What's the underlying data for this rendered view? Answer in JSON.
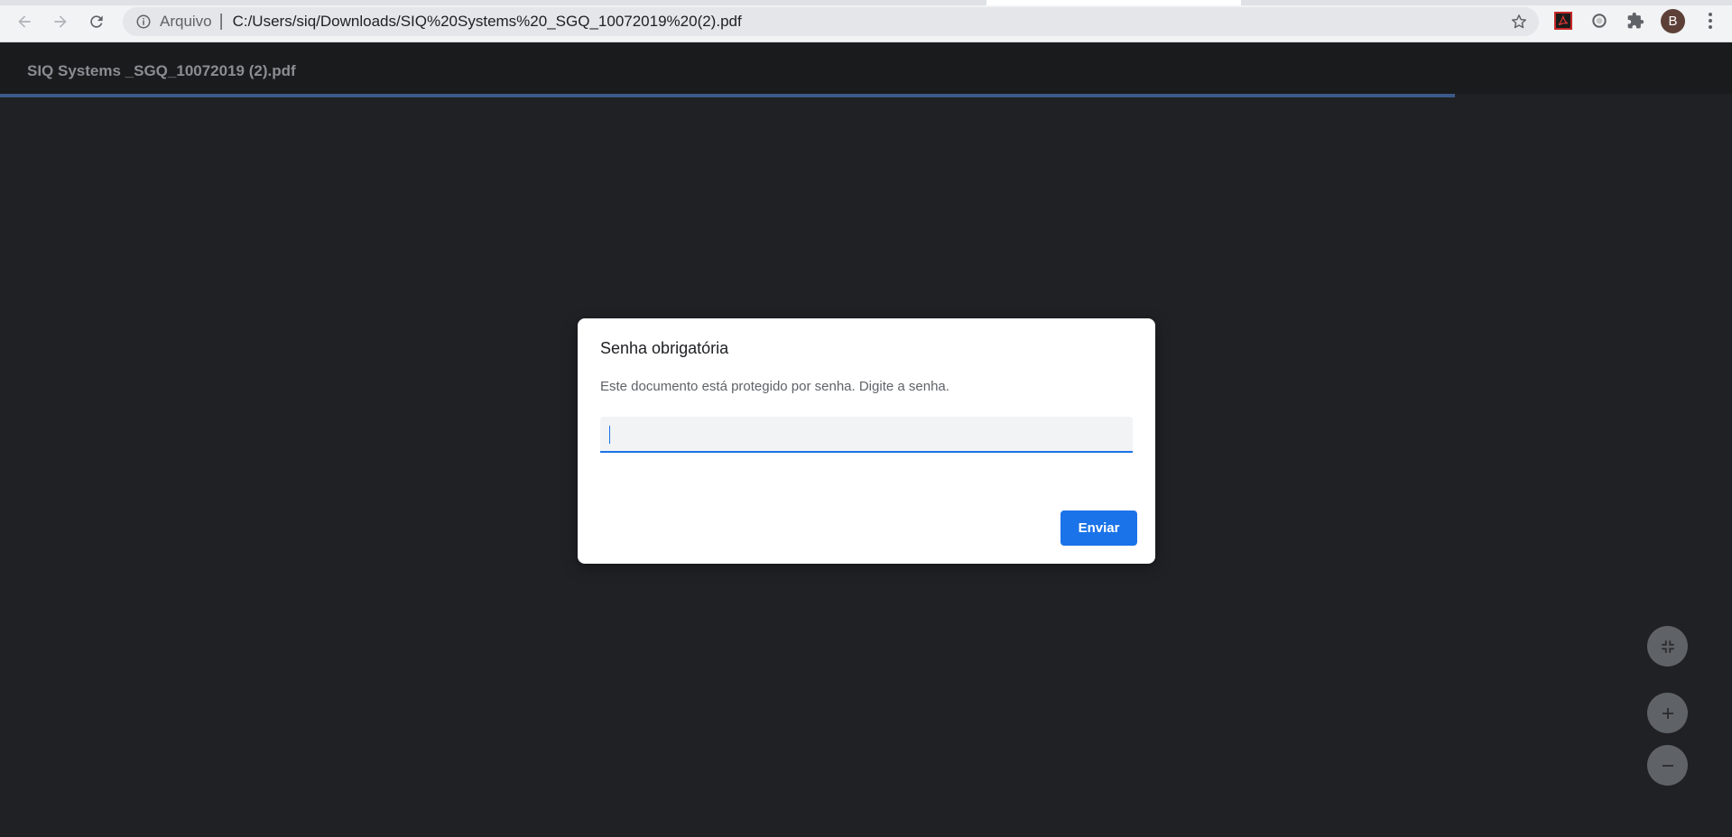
{
  "browser": {
    "omnibox": {
      "origin_label": "Arquivo",
      "separator": "|",
      "url": "C:/Users/siq/Downloads/SIQ%20Systems%20_SGQ_10072019%20(2).pdf"
    },
    "profile_initial": "B"
  },
  "pdf_viewer": {
    "title": "SIQ Systems _SGQ_10072019 (2).pdf",
    "load_progress_percent": 84
  },
  "password_dialog": {
    "title": "Senha obrigatória",
    "message": "Este documento está protegido por senha. Digite a senha.",
    "password_value": "",
    "submit_label": "Enviar"
  },
  "zoom_controls": {
    "fit_icon": "fit-to-page-icon",
    "zoom_in_icon": "plus-icon",
    "zoom_out_icon": "minus-icon"
  },
  "colors": {
    "accent": "#1a73e8",
    "viewer_background": "#202124",
    "header_background": "#191b1c"
  }
}
